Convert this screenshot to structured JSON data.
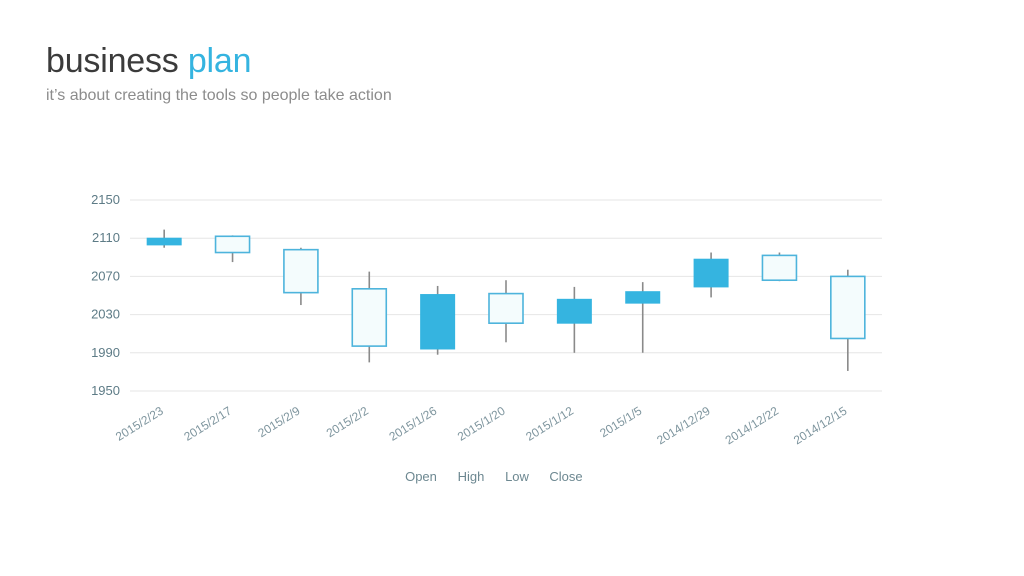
{
  "header": {
    "title_main": "business ",
    "title_accent": "plan",
    "subtitle": "it’s about creating the tools so people take action"
  },
  "colors": {
    "accent": "#35b4e0",
    "candle_up_fill": "#f4fcfd",
    "candle_stroke": "#4db4dc",
    "candle_down_fill": "#35b4e0",
    "wick": "#8a8a8a",
    "grid": "#e6e6e6",
    "tick_text": "#5d7b86",
    "title_text": "#3b3b3b",
    "subtitle_text": "#8c8c8c"
  },
  "chart_data": {
    "type": "candlestick",
    "title": "",
    "xlabel": "",
    "ylabel": "",
    "ylim": [
      1950,
      2150
    ],
    "yticks": [
      2150,
      2110,
      2070,
      2030,
      1990,
      1950
    ],
    "grid": true,
    "legend_position": "bottom",
    "legend": [
      "Open",
      "High",
      "Low",
      "Close"
    ],
    "categories": [
      "2015/2/23",
      "2015/2/17",
      "2015/2/9",
      "2015/2/2",
      "2015/1/26",
      "2015/1/20",
      "2015/1/12",
      "2015/1/5",
      "2014/12/29",
      "2014/12/22",
      "2014/12/15"
    ],
    "series": [
      {
        "name": "Open",
        "values": [
          2103,
          2095,
          2098,
          1997,
          2051,
          2021,
          2021,
          2042,
          2088,
          2066,
          2005
        ]
      },
      {
        "name": "High",
        "values": [
          2119,
          2113,
          2100,
          2075,
          2060,
          2066,
          2059,
          2064,
          2095,
          2095,
          2077
        ]
      },
      {
        "name": "Low",
        "values": [
          2100,
          2085,
          2040,
          1980,
          1988,
          2001,
          1990,
          1990,
          2048,
          2065,
          1971
        ]
      },
      {
        "name": "Close",
        "values": [
          2110,
          2112,
          2053,
          2057,
          1994,
          2052,
          2046,
          2054,
          2059,
          2092,
          2070
        ]
      }
    ],
    "candles": [
      {
        "label": "2015/2/23",
        "open": 2103,
        "high": 2119,
        "low": 2100,
        "close": 2110,
        "direction": "down"
      },
      {
        "label": "2015/2/17",
        "open": 2095,
        "high": 2113,
        "low": 2085,
        "close": 2112,
        "direction": "up"
      },
      {
        "label": "2015/2/9",
        "open": 2098,
        "high": 2100,
        "low": 2040,
        "close": 2053,
        "direction": "up"
      },
      {
        "label": "2015/2/2",
        "open": 1997,
        "high": 2075,
        "low": 1980,
        "close": 2057,
        "direction": "up"
      },
      {
        "label": "2015/1/26",
        "open": 2051,
        "high": 2060,
        "low": 1988,
        "close": 1994,
        "direction": "down"
      },
      {
        "label": "2015/1/20",
        "open": 2021,
        "high": 2066,
        "low": 2001,
        "close": 2052,
        "direction": "up"
      },
      {
        "label": "2015/1/12",
        "open": 2021,
        "high": 2059,
        "low": 1990,
        "close": 2046,
        "direction": "down"
      },
      {
        "label": "2015/1/5",
        "open": 2042,
        "high": 2064,
        "low": 1990,
        "close": 2054,
        "direction": "down"
      },
      {
        "label": "2014/12/29",
        "open": 2088,
        "high": 2095,
        "low": 2048,
        "close": 2059,
        "direction": "down"
      },
      {
        "label": "2014/12/22",
        "open": 2066,
        "high": 2095,
        "low": 2065,
        "close": 2092,
        "direction": "up"
      },
      {
        "label": "2014/12/15",
        "open": 2005,
        "high": 2077,
        "low": 1971,
        "close": 2070,
        "direction": "up"
      }
    ]
  }
}
